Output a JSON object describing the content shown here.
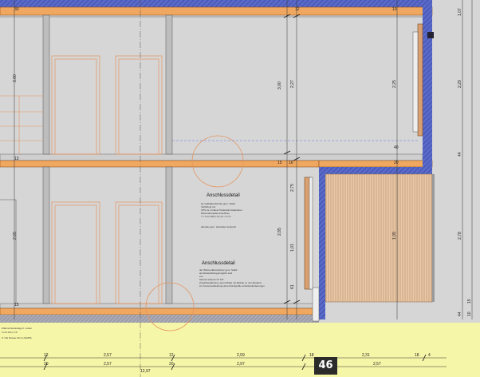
{
  "sheet": {
    "page_number": "46",
    "colors": {
      "paper": "#d6d6d6",
      "tint_strip": "#f6f6a8",
      "slab": "#f0a860",
      "insulation": "#5a6ac8",
      "frame": "#d9a072",
      "cladding": "#e8c9a8"
    }
  },
  "details": {
    "upper": {
      "title": "Anschlussdetail",
      "lines": [
        "lse Holbalkonbrücke gem. Statik",
        "Verfüllung mit",
        "XPS ca. mindest Tiefenwärmstauhanel",
        "Dämmoberseite-Anschluss",
        "Y = 0,xx W/(m·K), fxx = 0,7x"
      ],
      "extra": "alterativ gem. Hersteller Auskunft"
    },
    "lower": {
      "title": "Anschlussdetail",
      "lines": [
        "der Wärmedämmkörper gem. Statik",
        "als Weiterbildungsmöglich sind",
        "xxx",
        "Schöck Isokorb XT KIT",
        "Zusatzbewährung, wenn Platte mit Einbau xx mm Abstand",
        "zur Konterverkleidung ohne Rundprofile schutzanforderungen"
      ]
    }
  },
  "left_notes": [
    "Wärmschutzanlage lt. Gutter",
    "h min 8cm z=0",
    "Z. OG Niveau 30 cm IGMTE"
  ],
  "dimensions": {
    "storey_upper_left": "3.00",
    "storey_lower_left": "2.65",
    "right_column": [
      "3,00",
      "2,27",
      "2,85",
      "2,75",
      "1,01",
      "61",
      "2,25",
      "1,09"
    ],
    "slab_marks": [
      "30",
      "12",
      "10",
      "15",
      "16",
      "20",
      "40",
      "13",
      "15"
    ],
    "far_right": [
      "1,07",
      "2,29",
      "44",
      "2,78",
      "44",
      "10",
      "15"
    ],
    "bottom_row1": [
      "12",
      "2,57",
      "12",
      "2,59",
      "18",
      "2,31",
      "18",
      "4"
    ],
    "bottom_row2": [
      "20",
      "2,57",
      "20",
      "2,97",
      "2,57"
    ],
    "bottom_level": "12,97"
  }
}
